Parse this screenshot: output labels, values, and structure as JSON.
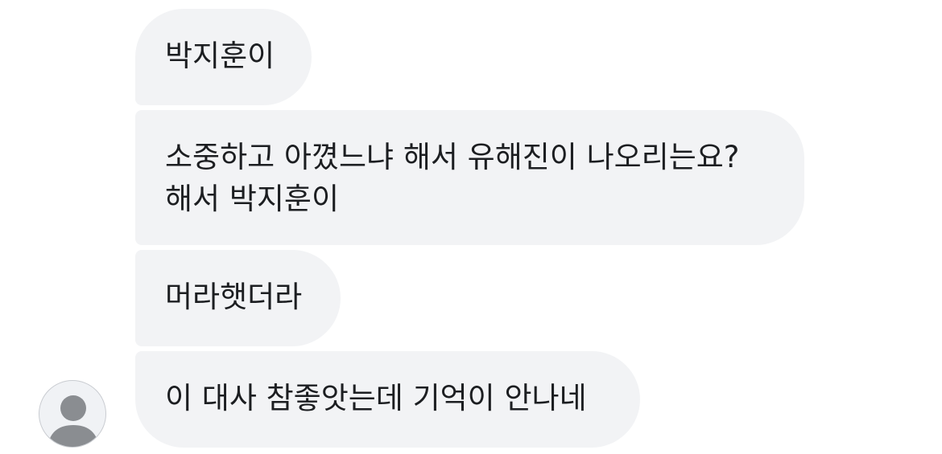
{
  "messages": [
    {
      "text": "박지훈이"
    },
    {
      "line1": "소중하고 아꼈느냐 해서 유해진이 나오리는요?",
      "line2": "해서 박지훈이"
    },
    {
      "text": "머라햇더라"
    },
    {
      "text": "이 대사 참좋앗는데 기억이 안나네"
    }
  ],
  "avatar": {
    "icon": "default-profile-icon",
    "bg_color": "#f0f2f5",
    "figure_color": "#8a8d91"
  },
  "colors": {
    "bubble_bg": "#f2f3f5",
    "text": "#1c1e21"
  }
}
